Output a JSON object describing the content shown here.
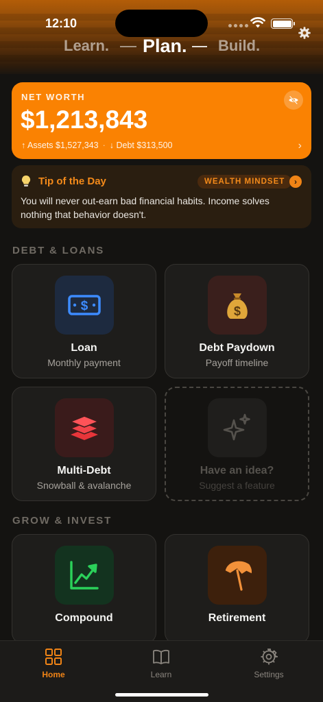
{
  "status_bar": {
    "time": "12:10"
  },
  "header": {
    "learn": "Learn.",
    "plan": "Plan.",
    "build": "Build.",
    "settings_icon": "gear-icon"
  },
  "net_worth": {
    "label": "NET WORTH",
    "value": "$1,213,843",
    "assets": "↑ Assets $1,527,343",
    "separator": "·",
    "debt": "↓ Debt $313,500",
    "hide_icon": "eye-slash-icon",
    "chevron": "›",
    "color": "#fa8202"
  },
  "tip": {
    "icon": "lightbulb-icon",
    "title": "Tip of the Day",
    "badge": "WEALTH MINDSET",
    "arrow": "›",
    "text": "You will never out-earn bad financial habits. Income solves nothing that behavior doesn't."
  },
  "sections": {
    "debt": "DEBT & LOANS",
    "grow": "GROW & INVEST"
  },
  "tiles": [
    {
      "title": "Loan",
      "subtitle": "Monthly payment",
      "icon": "dollar-bill-icon"
    },
    {
      "title": "Debt Paydown",
      "subtitle": "Payoff timeline",
      "icon": "money-bag-icon"
    },
    {
      "title": "Multi-Debt",
      "subtitle": "Snowball & avalanche",
      "icon": "layers-icon"
    },
    {
      "title": "Have an idea?",
      "subtitle": "Suggest a feature",
      "icon": "sparkles-icon"
    },
    {
      "title": "Compound",
      "subtitle": "",
      "icon": "chart-up-icon"
    },
    {
      "title": "Retirement",
      "subtitle": "",
      "icon": "beach-umbrella-icon"
    }
  ],
  "tabbar": {
    "items": [
      {
        "label": "Home",
        "icon": "grid-icon",
        "active": true
      },
      {
        "label": "Learn",
        "icon": "book-icon",
        "active": false
      },
      {
        "label": "Settings",
        "icon": "gear-icon",
        "active": false
      }
    ],
    "accent": "#f08416"
  }
}
